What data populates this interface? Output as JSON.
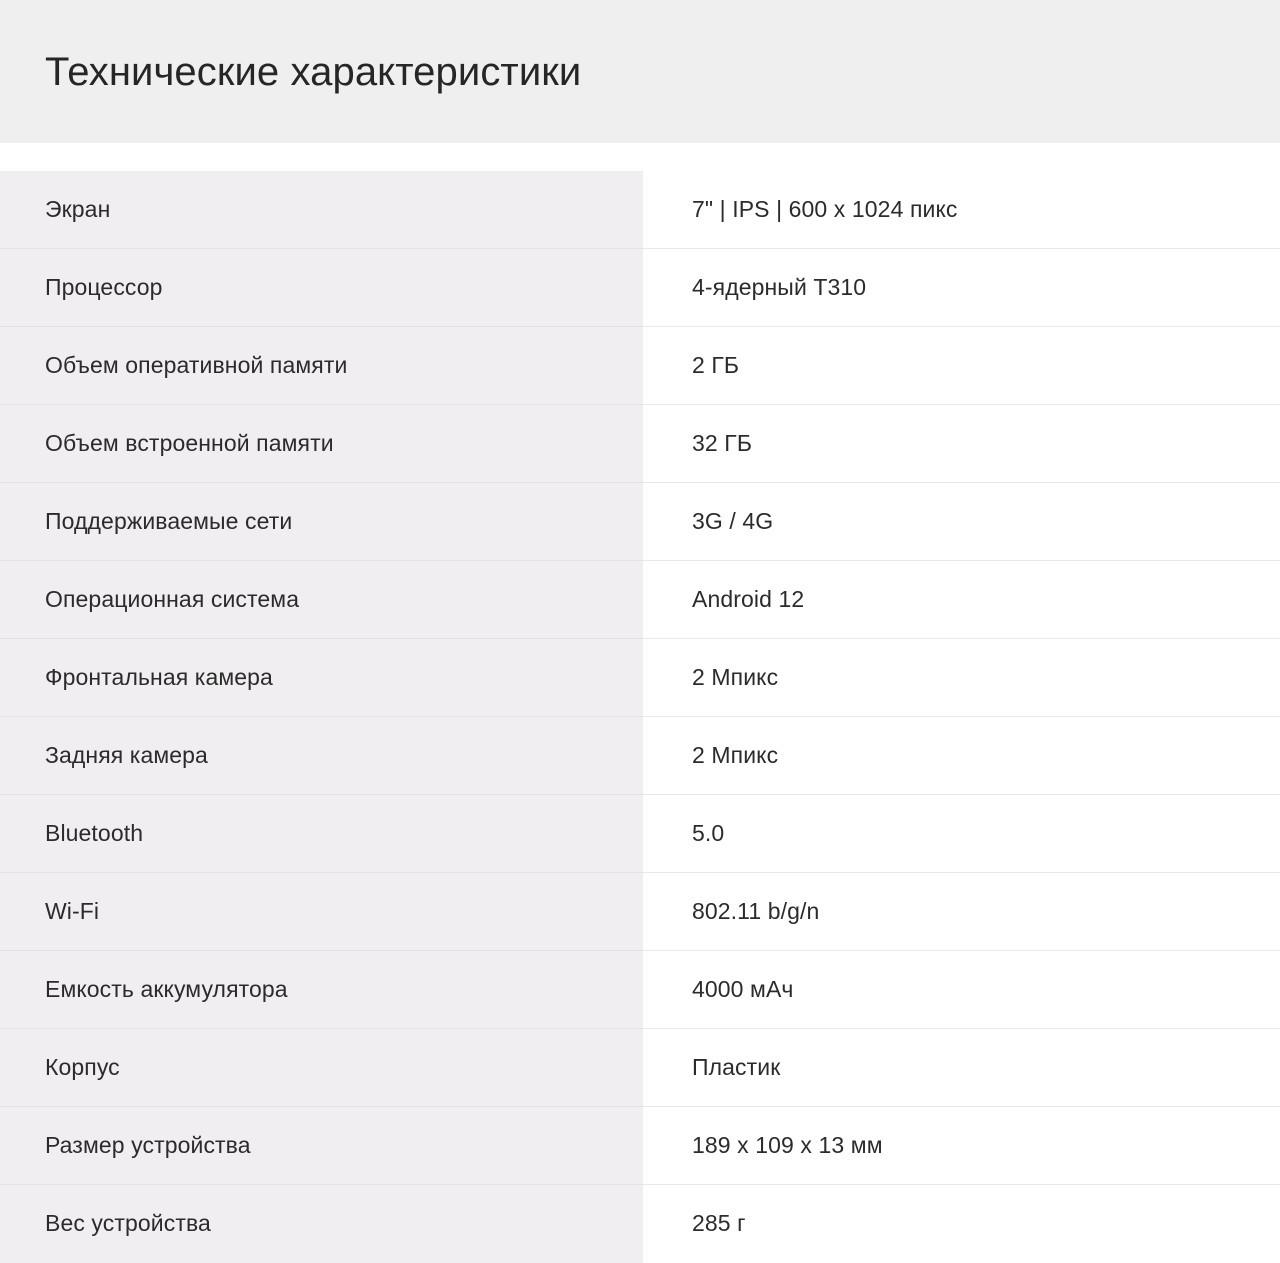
{
  "header": {
    "title": "Технические характеристики",
    "background_color": "#f0eff0"
  },
  "colors": {
    "label_column_bg": "#f0eef0",
    "value_column_bg": "#ffffff",
    "text": "#2b2b2b",
    "divider": "#e8e8e8"
  },
  "spec_table": {
    "rows": [
      {
        "label": "Экран",
        "value": "7\" | IPS | 600 x 1024 пикс"
      },
      {
        "label": "Процессор",
        "value": "4-ядерный T310"
      },
      {
        "label": "Объем оперативной памяти",
        "value": "2 ГБ"
      },
      {
        "label": "Объем встроенной памяти",
        "value": "32 ГБ"
      },
      {
        "label": "Поддерживаемые сети",
        "value": "3G / 4G"
      },
      {
        "label": "Операционная система",
        "value": "Android 12"
      },
      {
        "label": "Фронтальная камера",
        "value": "2 Мпикс"
      },
      {
        "label": "Задняя камера",
        "value": "2 Мпикс"
      },
      {
        "label": "Bluetooth",
        "value": "5.0"
      },
      {
        "label": "Wi-Fi",
        "value": "802.11 b/g/n"
      },
      {
        "label": "Емкость аккумулятора",
        "value": "4000 мАч"
      },
      {
        "label": "Корпус",
        "value": "Пластик"
      },
      {
        "label": "Размер устройства",
        "value": "189 x 109 x 13 мм"
      },
      {
        "label": "Вес устройства",
        "value": "285 г"
      }
    ]
  }
}
